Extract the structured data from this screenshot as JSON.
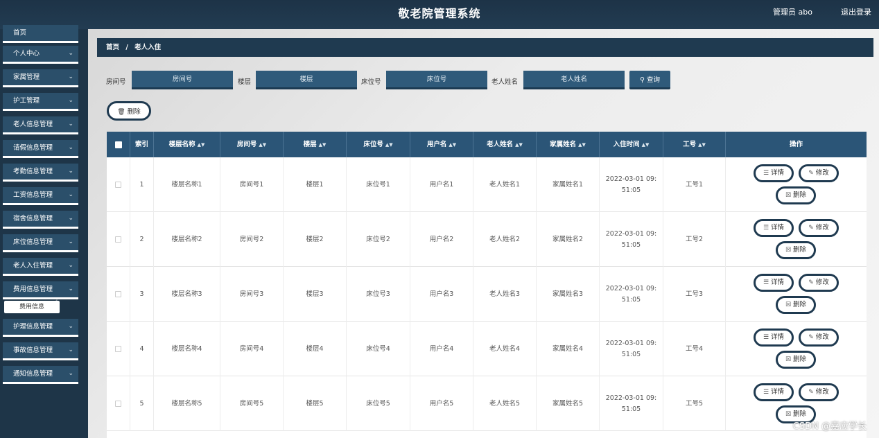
{
  "header": {
    "title": "敬老院管理系统",
    "user": "管理员 abo",
    "logout": "退出登录"
  },
  "sidebar": {
    "items": [
      {
        "label": "首页"
      },
      {
        "label": "个人中心"
      },
      {
        "label": "家属管理"
      },
      {
        "label": "护工管理"
      },
      {
        "label": "老人信息管理"
      },
      {
        "label": "请假信息管理"
      },
      {
        "label": "考勤信息管理"
      },
      {
        "label": "工资信息管理"
      },
      {
        "label": "宿舍信息管理"
      },
      {
        "label": "床位信息管理"
      },
      {
        "label": "老人入住管理"
      },
      {
        "label": "费用信息管理"
      },
      {
        "label": "护理信息管理"
      },
      {
        "label": "事故信息管理"
      },
      {
        "label": "通知信息管理"
      }
    ],
    "submenu": "费用信息"
  },
  "breadcrumb": {
    "home": "首页",
    "separator": "/",
    "current": "老人入住"
  },
  "search": {
    "room_label": "房间号",
    "room_placeholder": "房间号",
    "floor_label": "楼层",
    "floor_placeholder": "楼层",
    "bed_label": "床位号",
    "bed_placeholder": "床位号",
    "name_label": "老人姓名",
    "name_placeholder": "老人姓名",
    "query_button": "查询"
  },
  "toolbar": {
    "delete_button": "删除"
  },
  "table": {
    "headers": [
      "索引",
      "楼层名称",
      "房间号",
      "楼层",
      "床位号",
      "用户名",
      "老人姓名",
      "家属姓名",
      "入住时间",
      "工号",
      "操作"
    ],
    "rows": [
      [
        "1",
        "楼层名称1",
        "房间号1",
        "楼层1",
        "床位号1",
        "用户名1",
        "老人姓名1",
        "家属姓名1",
        "2022-03-01 09:51:05",
        "工号1"
      ],
      [
        "2",
        "楼层名称2",
        "房间号2",
        "楼层2",
        "床位号2",
        "用户名2",
        "老人姓名2",
        "家属姓名2",
        "2022-03-01 09:51:05",
        "工号2"
      ],
      [
        "3",
        "楼层名称3",
        "房间号3",
        "楼层3",
        "床位号3",
        "用户名3",
        "老人姓名3",
        "家属姓名3",
        "2022-03-01 09:51:05",
        "工号3"
      ],
      [
        "4",
        "楼层名称4",
        "房间号4",
        "楼层4",
        "床位号4",
        "用户名4",
        "老人姓名4",
        "家属姓名4",
        "2022-03-01 09:51:05",
        "工号4"
      ],
      [
        "5",
        "楼层名称5",
        "房间号5",
        "楼层5",
        "床位号5",
        "用户名5",
        "老人姓名5",
        "家属姓名5",
        "2022-03-01 09:51:05",
        "工号5"
      ]
    ],
    "actions": {
      "detail": "详情",
      "edit": "修改",
      "delete": "删除"
    }
  },
  "watermark": "CSDN @嘉应学长",
  "colors": {
    "header_bg": "#1d3347",
    "sidebar_bg": "#1e3548",
    "menu_item_bg": "#2b4f6a",
    "table_head_bg": "#2b5577",
    "button_border": "#1f3a50"
  }
}
